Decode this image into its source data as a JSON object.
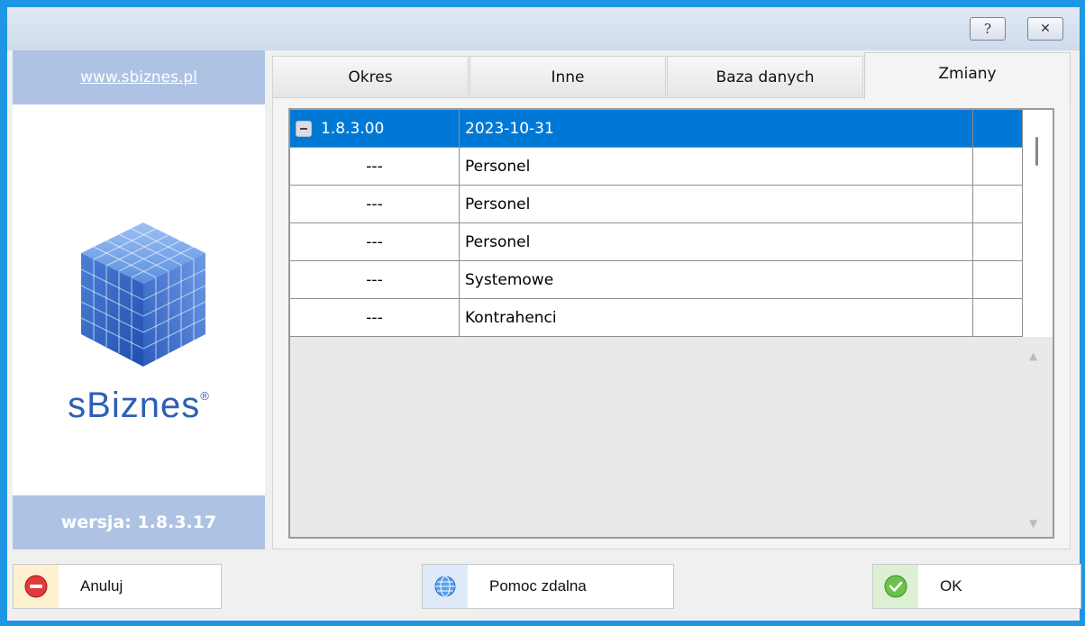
{
  "titlebar": {
    "help_glyph": "?",
    "close_glyph": "✕"
  },
  "left_panel": {
    "site_link": "www.sbiznes.pl",
    "brand_name": "sBiznes",
    "brand_reg": "®",
    "version_label": "wersja: 1.8.3.17",
    "logo_icon": "cube-logo-icon"
  },
  "tabs": [
    {
      "label": "Okres"
    },
    {
      "label": "Inne"
    },
    {
      "label": "Baza danych"
    },
    {
      "label": "Zmiany",
      "active": true
    }
  ],
  "grid": {
    "rows": [
      {
        "version": "1.8.3.00",
        "description": "2023-10-31",
        "selected": true,
        "expander": "collapse-icon"
      },
      {
        "version": "---",
        "description": "Personel"
      },
      {
        "version": "---",
        "description": "Personel"
      },
      {
        "version": "---",
        "description": "Personel"
      },
      {
        "version": "---",
        "description": "Systemowe"
      },
      {
        "version": "---",
        "description": "Kontrahenci"
      }
    ],
    "scroll_up_glyph": "▲",
    "scroll_down_glyph": "▼"
  },
  "buttons": {
    "cancel_label": "Anuluj",
    "remote_label": "Pomoc zdalna",
    "ok_label": "OK",
    "cancel_icon": "no-entry-icon",
    "remote_icon": "globe-icon",
    "ok_icon": "checkmark-icon"
  },
  "colors": {
    "selection": "#0079d6",
    "brand_blue": "#2d5fb5",
    "panel_band": "#aec3e3"
  }
}
